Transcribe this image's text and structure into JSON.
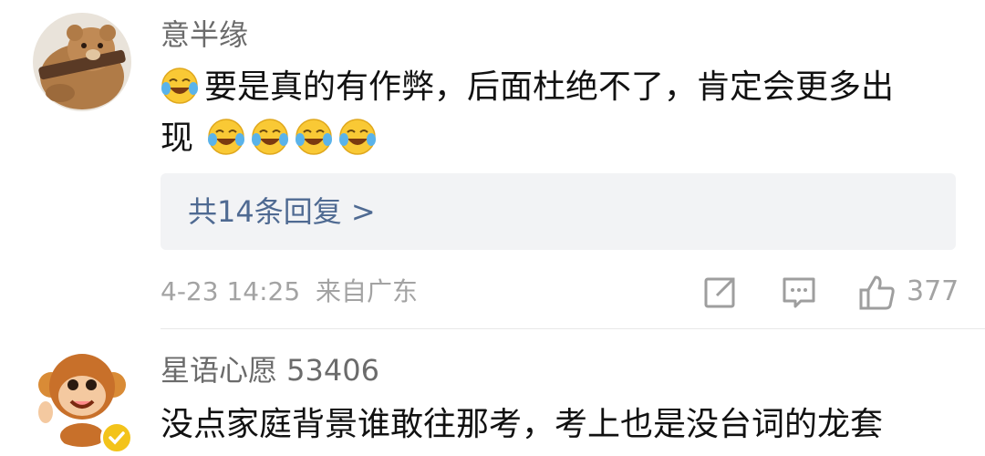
{
  "comments": [
    {
      "username": "意半缘",
      "text_line1": "要是真的有作弊，后面杜绝不了，肯定会更多出",
      "text_line2": "现",
      "replies_label": "共14条回复 >",
      "timestamp": "4-23 14:25",
      "location": "来自广东",
      "like_count": "377",
      "avatar_icon": "bear-plush-avatar",
      "emoji_icon": "laugh-cry-emoji"
    },
    {
      "username": "星语心愿 53406",
      "text_line1": "没点家庭背景谁敢往那考，考上也是没台词的龙套",
      "avatar_icon": "monkey-cartoon-avatar",
      "badge_icon": "verified-badge-icon"
    }
  ],
  "colors": {
    "username": "#6b6b6b",
    "link": "#4f6a92",
    "meta": "#a3a3a3",
    "reply_bg": "#f2f3f5",
    "badge": "#f3c31a"
  }
}
